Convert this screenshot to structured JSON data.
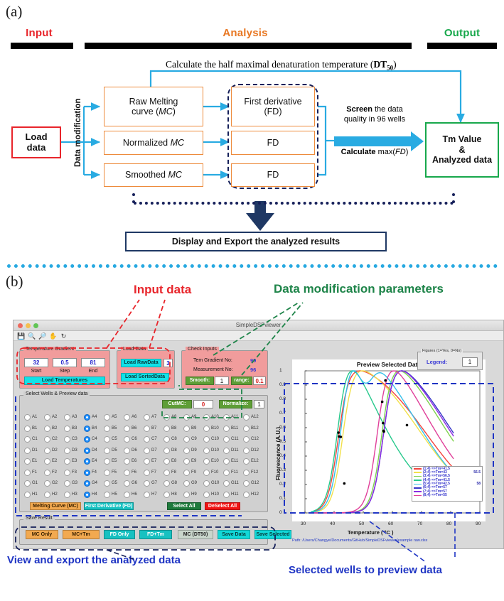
{
  "panel_a": {
    "letter": "(a)",
    "columns": [
      {
        "label": "Input",
        "color": "#E8252B"
      },
      {
        "label": "Analysis",
        "color": "#E87722"
      },
      {
        "label": "Output",
        "color": "#17A84B"
      }
    ],
    "equation_prefix": "Calculate the half maximal denaturation temperature (",
    "equation_term": "DT",
    "equation_sub": "50",
    "equation_suffix": ")",
    "input_box": "Load\ndata",
    "vertical_label": "Data modification",
    "mc_boxes": [
      {
        "line1": "Raw Melting",
        "line2": "curve (MC)"
      },
      {
        "line1": "Normalized MC",
        "line2": ""
      },
      {
        "line1": "Smoothed MC",
        "line2": ""
      }
    ],
    "fd_boxes": [
      {
        "line1": "First derivative",
        "line2": "(FD)"
      },
      {
        "line1": "FD",
        "line2": ""
      },
      {
        "line1": "FD",
        "line2": ""
      }
    ],
    "screen_line1_bold": "Screen",
    "screen_line1_rest": " the data",
    "screen_line2": "quality in 96 wells",
    "screen_line3_bold": "Calculate",
    "screen_line3_rest": " max(FD)",
    "output_box": [
      "Tm Value",
      "&",
      "Analyzed data"
    ],
    "bottom_box": "Display and Export the analyzed results"
  },
  "panel_b": {
    "letter": "(b)",
    "annotations": {
      "input_data": "Input data",
      "data_mod": "Data modification parameters",
      "view_export": "View and export the analyzed data",
      "selected_wells": "Selected wells to preview data"
    },
    "window_title": "SimpleDSFviewer",
    "toolbar_icons": [
      "save-icon",
      "zoom-in-icon",
      "zoom-out-icon",
      "pan-icon",
      "reset-icon"
    ],
    "temperature_gradient": {
      "title": "Temperature Gradient",
      "start_value": "32",
      "step_value": "0.5",
      "end_value": "81",
      "start_label": "Start",
      "step_label": "Step",
      "end_label": "End",
      "load_button": "Load Temperatures"
    },
    "load_data": {
      "title": "Load Data",
      "raw_button": "Load RawData",
      "raw_value": "3",
      "sorted_button": "Load SortedData"
    },
    "check_inputs": {
      "title": "Check Inputs",
      "tem_gradient_label": "Tem Gradient No:",
      "tem_gradient_value": "99",
      "measurement_label": "Measurement No:",
      "measurement_value": "96",
      "smooth_label": "Smooth:",
      "smooth_value": "1",
      "range_label": "range:",
      "range_value": "0.1"
    },
    "wells_panel": {
      "title": "Select Wells & Preview data",
      "cutmc_label": "CutMC:",
      "cutmc_value": "0",
      "normalize_label": "Normalize:",
      "normalize_value": "1",
      "rows": [
        "A",
        "B",
        "C",
        "D",
        "E",
        "F",
        "G",
        "H"
      ],
      "cols": [
        1,
        2,
        3,
        4,
        5,
        6,
        7,
        8,
        9,
        10,
        11,
        12
      ],
      "selected_col": 4,
      "buttons": [
        {
          "label": "Melting Curve (MC)",
          "style": "orange"
        },
        {
          "label": "First Derivative (FD)",
          "style": "teal"
        },
        {
          "label": "Select All",
          "style": "dgreen"
        },
        {
          "label": "DeSelect All",
          "style": "red"
        }
      ]
    },
    "save_result": {
      "title": "Save Result",
      "buttons": [
        {
          "label": "MC Only",
          "style": "orange"
        },
        {
          "label": "MC+Tm",
          "style": "orange"
        },
        {
          "label": "FD Only",
          "style": "teal"
        },
        {
          "label": "FD+Tm",
          "style": "teal"
        },
        {
          "label": "MC (DT50)",
          "style": "grey"
        },
        {
          "label": "Save Data",
          "style": "cy2"
        },
        {
          "label": "Save Selected",
          "style": "cy2"
        }
      ]
    },
    "figures_box": {
      "title": "Figures (1=Yes, 0=No)",
      "legend_label": "Legend:",
      "legend_value": "1"
    },
    "path_text": "Path: /Users/Changye/Documents/GitHub/SimpleDSFviewer/example raw.xlsx"
  },
  "chart_data": {
    "type": "line",
    "title": "Preview Selected Data",
    "xlabel": "Temperature ( °C )",
    "ylabel": "Fluorescence (A.U.)",
    "xlim": [
      30,
      90
    ],
    "ylim": [
      0,
      1
    ],
    "xticks": [
      30,
      40,
      50,
      60,
      70,
      80,
      90
    ],
    "yticks": [
      0,
      0.1,
      0.2,
      0.3,
      0.4,
      0.5,
      0.6,
      0.7,
      0.8,
      0.9,
      1
    ],
    "grid": false,
    "legend_position": "lower-right",
    "series": [
      {
        "name": "(1;4) =>Tm=41.5",
        "color": "#F4443C",
        "tm": 41.5,
        "extra": "",
        "marker": {
          "x": 41.5,
          "y": 0.565
        }
      },
      {
        "name": "(2;4) =>Tm=43",
        "color": "#F2E14A",
        "tm": 43,
        "extra": "56.5",
        "marker": {
          "x": 43.5,
          "y": 0.207
        }
      },
      {
        "name": "(3;4) =>Tm=56.5",
        "color": "#7FD34F",
        "tm": 56.5,
        "extra": "",
        "marker": {
          "x": 56.8,
          "y": 0.632
        }
      },
      {
        "name": "(4;4) =>Tm=41.5",
        "color": "#27C98C",
        "tm": 41.5,
        "extra": "",
        "marker": {
          "x": 41.7,
          "y": 0.538
        }
      },
      {
        "name": "(5;4) =>Tm=42.5",
        "color": "#36BFEA",
        "tm": 42.5,
        "extra": "58",
        "marker": {
          "x": 42.3,
          "y": 0.535
        }
      },
      {
        "name": "(6;4) =>Tm=57",
        "color": "#3535C8",
        "tm": 57,
        "extra": "",
        "marker": {
          "x": 57.1,
          "y": 0.573
        }
      },
      {
        "name": "(7;4) =>Tm=57",
        "color": "#8A2BE2",
        "tm": 57,
        "extra": "",
        "marker": {
          "x": 57.0,
          "y": 0.578
        }
      },
      {
        "name": "(8;4) =>Tm=55",
        "color": "#E0409A",
        "tm": 55,
        "extra": "",
        "marker": {
          "x": 65.0,
          "y": 0.618
        }
      }
    ],
    "extra_markers": [
      {
        "x": 57.6,
        "y": 0.932
      },
      {
        "x": 56.5,
        "y": 0.782
      }
    ]
  }
}
